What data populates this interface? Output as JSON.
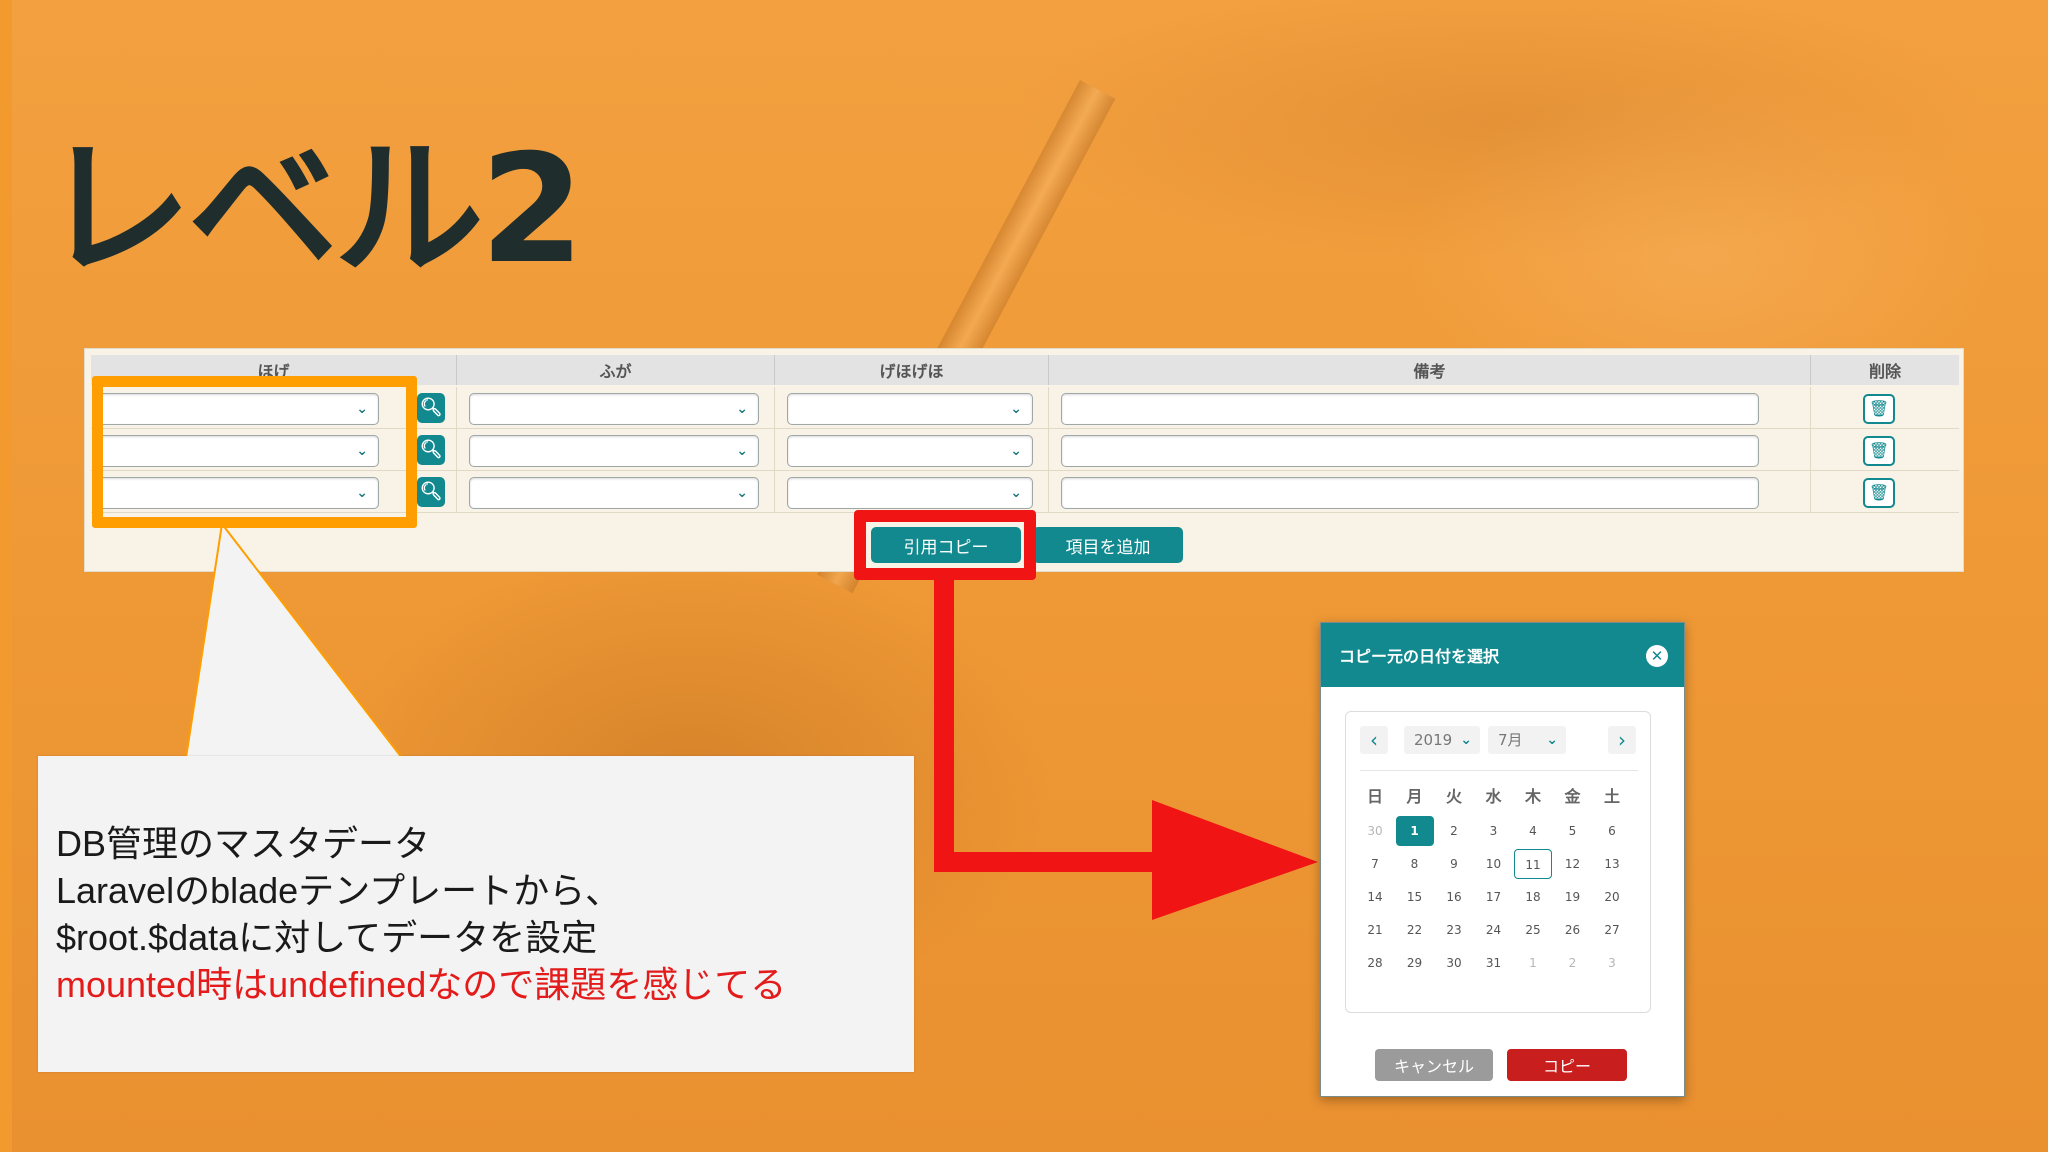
{
  "slide": {
    "title": "レベル2"
  },
  "grid": {
    "headers": [
      "ほげ",
      "ふが",
      "げほげほ",
      "備考",
      "削除"
    ],
    "rows": [
      {
        "hoge": "",
        "fuga": "",
        "gehogeho": "",
        "note": ""
      },
      {
        "hoge": "",
        "fuga": "",
        "gehogeho": "",
        "note": ""
      },
      {
        "hoge": "",
        "fuga": "",
        "gehogeho": "",
        "note": ""
      }
    ]
  },
  "icons": {
    "dropdown": "chevron-down-icon",
    "search": "search-icon",
    "delete": "trash-icon",
    "close": "close-icon"
  },
  "buttons": {
    "quote_copy": "引用コピー",
    "add_item": "項目を追加"
  },
  "callout": {
    "lines": [
      "DB管理のマスタデータ",
      "Laravelのbladeテンプレートから、",
      "$root.$dataに対してデータを設定"
    ],
    "highlight": "mounted時はundefinedなので課題を感じてる"
  },
  "dialog": {
    "title": "コピー元の日付を選択",
    "year": "2019",
    "month": "7月",
    "weekdays": [
      "日",
      "月",
      "火",
      "水",
      "木",
      "金",
      "土"
    ],
    "weeks": [
      [
        "30",
        "1",
        "2",
        "3",
        "4",
        "5",
        "6"
      ],
      [
        "7",
        "8",
        "9",
        "10",
        "11",
        "12",
        "13"
      ],
      [
        "14",
        "15",
        "16",
        "17",
        "18",
        "19",
        "20"
      ],
      [
        "21",
        "22",
        "23",
        "24",
        "25",
        "26",
        "27"
      ],
      [
        "28",
        "29",
        "30",
        "31",
        "1",
        "2",
        "3"
      ]
    ],
    "selected_day": "1",
    "today_day": "11",
    "cancel_label": "キャンセル",
    "copy_label": "コピー"
  },
  "colors": {
    "teal": "#12898F",
    "highlight_orange": "#FF9E00",
    "highlight_red": "#F01414",
    "danger": "#C91E1E",
    "background": "#F4A23F"
  }
}
